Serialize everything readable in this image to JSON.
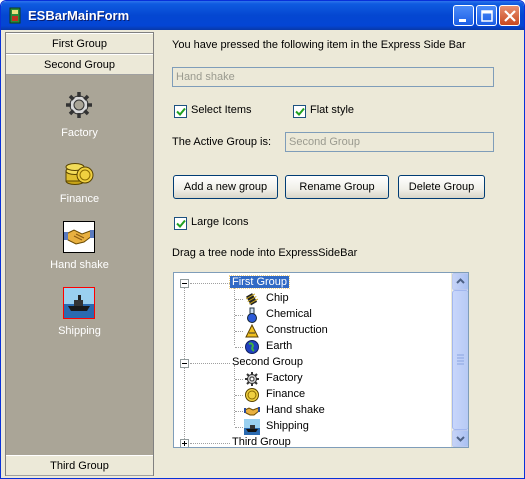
{
  "window": {
    "title": "ESBarMainForm"
  },
  "sidebar": {
    "groups": [
      {
        "label": "First Group"
      },
      {
        "label": "Second Group"
      },
      {
        "label": "Third Group"
      }
    ],
    "items": [
      {
        "label": "Factory",
        "icon": "gear-icon"
      },
      {
        "label": "Finance",
        "icon": "coins-icon"
      },
      {
        "label": "Hand shake",
        "icon": "handshake-icon"
      },
      {
        "label": "Shipping",
        "icon": "ship-icon"
      }
    ]
  },
  "main": {
    "pressed_label": "You have pressed the  following item in the Express Side Bar",
    "pressed_value": "Hand shake",
    "select_items_label": "Select Items",
    "select_items_checked": true,
    "flat_style_label": "Flat style",
    "flat_style_checked": true,
    "active_group_label": "The Active Group is:",
    "active_group_value": "Second Group",
    "add_group_button": "Add a new group",
    "rename_group_button": "Rename Group",
    "delete_group_button": "Delete Group",
    "large_icons_label": "Large Icons",
    "large_icons_checked": true,
    "drag_hint": "Drag a tree node into ExpressSideBar"
  },
  "tree": {
    "nodes": [
      {
        "label": "First Group",
        "level": 0,
        "expanded": true,
        "selected": true
      },
      {
        "label": "Chip",
        "level": 1,
        "icon": "chip-icon"
      },
      {
        "label": "Chemical",
        "level": 1,
        "icon": "flask-icon"
      },
      {
        "label": "Construction",
        "level": 1,
        "icon": "construction-icon"
      },
      {
        "label": "Earth",
        "level": 1,
        "icon": "earth-icon"
      },
      {
        "label": "Second Group",
        "level": 0,
        "expanded": true
      },
      {
        "label": "Factory",
        "level": 1,
        "icon": "gear-icon"
      },
      {
        "label": "Finance",
        "level": 1,
        "icon": "coins-icon"
      },
      {
        "label": "Hand shake",
        "level": 1,
        "icon": "handshake-icon"
      },
      {
        "label": "Shipping",
        "level": 1,
        "icon": "ship-icon"
      },
      {
        "label": "Third Group",
        "level": 0,
        "expanded": false
      }
    ]
  },
  "colors": {
    "titlebar": "#0447d1",
    "sidebar_bg": "#aaa597",
    "dialog_bg": "#ece9d8",
    "selection": "#316ac5"
  }
}
